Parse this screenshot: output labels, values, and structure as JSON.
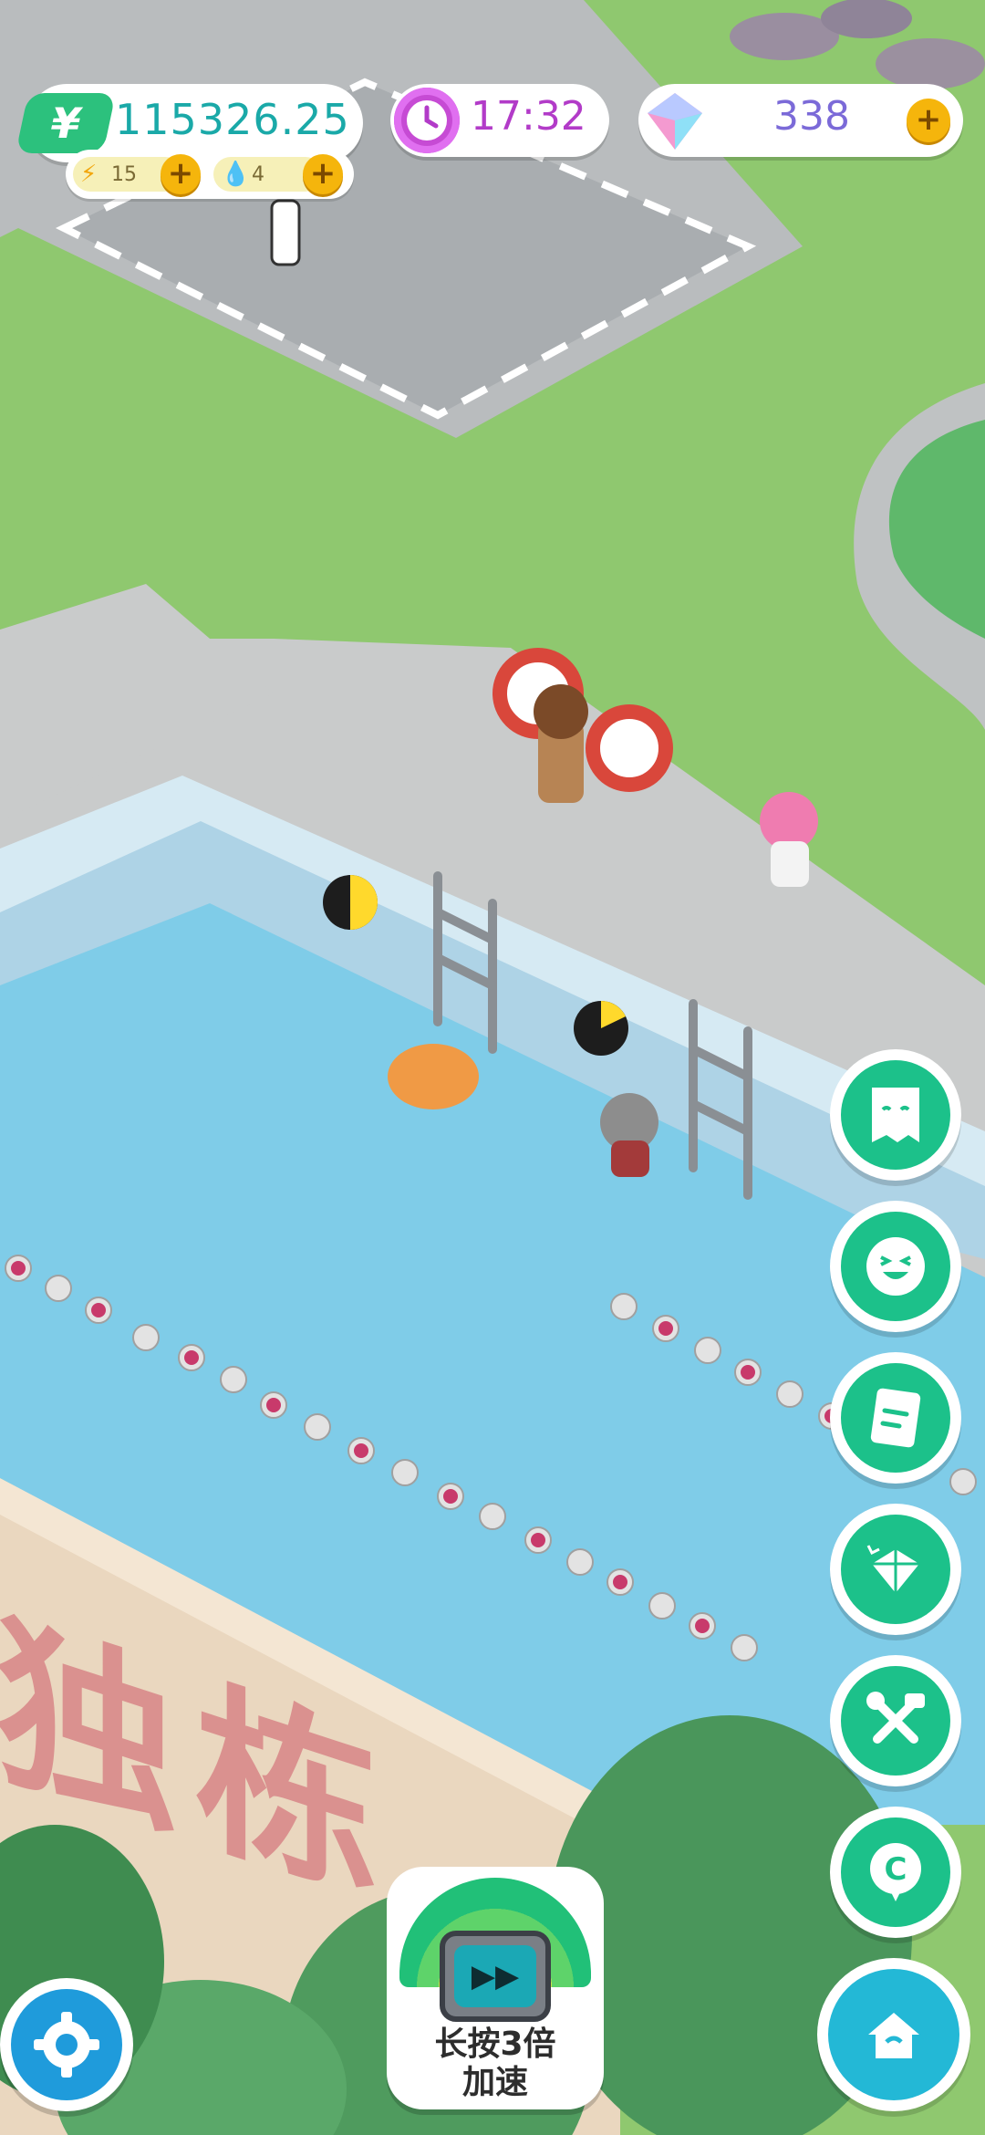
{
  "hud": {
    "money_symbol": "¥",
    "money": "115326.25",
    "energy": "15",
    "water": "4",
    "plus": "+",
    "clock": "17:32",
    "gems": "338"
  },
  "side_buttons": [
    {
      "name": "ghost-task-button",
      "icon": "ghost-paper-icon"
    },
    {
      "name": "emoji-button",
      "icon": "laughing-face-icon"
    },
    {
      "name": "notes-button",
      "icon": "notebook-icon"
    },
    {
      "name": "gem-shop-button",
      "icon": "gem-icon"
    },
    {
      "name": "tools-button",
      "icon": "wrench-hammer-icon"
    },
    {
      "name": "chat-coupon-button",
      "icon": "c-chat-icon"
    },
    {
      "name": "home-button",
      "icon": "home-icon"
    }
  ],
  "speed_button": {
    "line1": "长按3倍",
    "line2": "加速"
  },
  "pool_sign": "独栋",
  "colors": {
    "grass": "#8fc86f",
    "pool_water": "#7fcce8",
    "accent_green": "#1cc18a",
    "money_text": "#1aa9a8",
    "clock_text": "#b23bc8",
    "gem_text": "#7b6ad8"
  }
}
